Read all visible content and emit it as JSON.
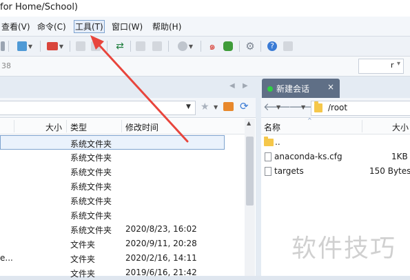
{
  "title": {
    "text": "for Home/School)"
  },
  "menu": {
    "items": [
      "查看(V)",
      "命令(C)",
      "工具(T)",
      "窗口(W)",
      "帮助(H)"
    ]
  },
  "address": {
    "left_fragment": "38",
    "right_value": "r"
  },
  "tab": {
    "label": "新建会话",
    "close": "×"
  },
  "left_pane": {
    "columns": {
      "size": "大小",
      "type": "类型",
      "modified": "修改时间"
    },
    "rows": [
      {
        "name": "",
        "size": "",
        "type": "系统文件夹",
        "modified": ""
      },
      {
        "name": "",
        "size": "",
        "type": "系统文件夹",
        "modified": ""
      },
      {
        "name": "",
        "size": "",
        "type": "系统文件夹",
        "modified": ""
      },
      {
        "name": "",
        "size": "",
        "type": "系统文件夹",
        "modified": ""
      },
      {
        "name": "",
        "size": "",
        "type": "系统文件夹",
        "modified": ""
      },
      {
        "name": "",
        "size": "",
        "type": "系统文件夹",
        "modified": ""
      },
      {
        "name": "",
        "size": "",
        "type": "系统文件夹",
        "modified": "2020/8/23, 16:02"
      },
      {
        "name": "",
        "size": "",
        "type": "文件夹",
        "modified": "2020/9/11, 20:28"
      },
      {
        "name": "e...",
        "size": "",
        "type": "文件夹",
        "modified": "2020/2/16, 14:11"
      },
      {
        "name": "",
        "size": "",
        "type": "文件夹",
        "modified": "2019/6/16, 21:42"
      }
    ]
  },
  "right_pane": {
    "path": "/root",
    "columns": {
      "name": "名称",
      "size": "大小"
    },
    "rows": [
      {
        "name": "..",
        "size": "",
        "icon": "folder-icon"
      },
      {
        "name": "anaconda-ks.cfg",
        "size": "1KB",
        "icon": "file-icon"
      },
      {
        "name": "targets",
        "size": "150 Bytes",
        "icon": "file-icon"
      }
    ]
  },
  "watermark": {
    "text": "软件技巧"
  },
  "colors": {
    "accent_tab": "#5f6f86",
    "status_dot": "#2fd044",
    "arrow": "#e8453c",
    "selection_border": "#7da2ce"
  }
}
